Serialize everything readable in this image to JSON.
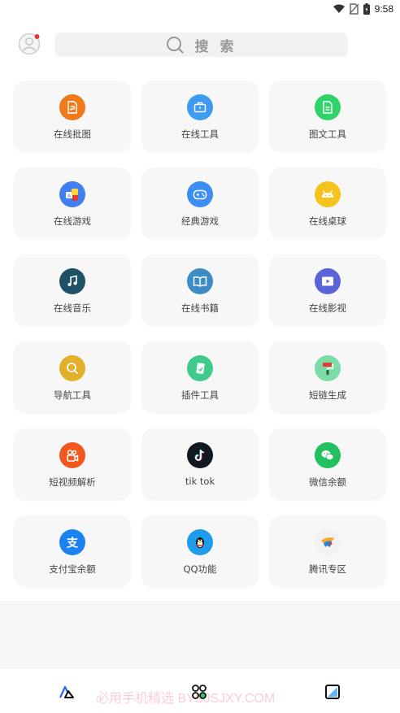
{
  "status_bar": {
    "time": "9:58"
  },
  "search": {
    "placeholder": "搜 索"
  },
  "tiles": [
    {
      "label": "在线批图",
      "icon": "image-file-icon",
      "color": "#F07A1A"
    },
    {
      "label": "在线工具",
      "icon": "toolbox-icon",
      "color": "#3D9BF0"
    },
    {
      "label": "图文工具",
      "icon": "document-icon",
      "color": "#2FD36A"
    },
    {
      "label": "在线游戏",
      "icon": "game-cubes-icon",
      "color": "#3F7FF0"
    },
    {
      "label": "经典游戏",
      "icon": "gamepad-icon",
      "color": "#3D8EF2"
    },
    {
      "label": "在线桌球",
      "icon": "robot-icon",
      "color": "#F6C21C"
    },
    {
      "label": "在线音乐",
      "icon": "music-note-icon",
      "color": "#1E5066"
    },
    {
      "label": "在线书籍",
      "icon": "open-book-icon",
      "color": "#3C8DC4"
    },
    {
      "label": "在线影视",
      "icon": "video-play-icon",
      "color": "#5B63D9"
    },
    {
      "label": "导航工具",
      "icon": "magnifier-icon",
      "color": "#E2B02A"
    },
    {
      "label": "插件工具",
      "icon": "plugin-card-icon",
      "color": "#3FCB8C"
    },
    {
      "label": "短链生成",
      "icon": "paint-roller-icon",
      "color": "#7DDBA8"
    },
    {
      "label": "短视频解析",
      "icon": "kuaishou-icon",
      "color": "#F2571E"
    },
    {
      "label": "tik tok",
      "icon": "tiktok-icon",
      "color": "#101820"
    },
    {
      "label": "微信余额",
      "icon": "wechat-icon",
      "color": "#20C15E"
    },
    {
      "label": "支付宝余额",
      "icon": "alipay-icon",
      "color": "#1B82F0"
    },
    {
      "label": "QQ功能",
      "icon": "qq-penguin-icon",
      "color": "#1E9BEB"
    },
    {
      "label": "腾讯专区",
      "icon": "tencent-game-icon",
      "color": "#F2F2F2"
    }
  ],
  "watermark": "必用手机精选 BYSJSJXY.COM",
  "colors": {
    "accent_red": "#E53935",
    "tile_bg": "#F7F7F7",
    "search_bg": "#F2F2F2"
  }
}
